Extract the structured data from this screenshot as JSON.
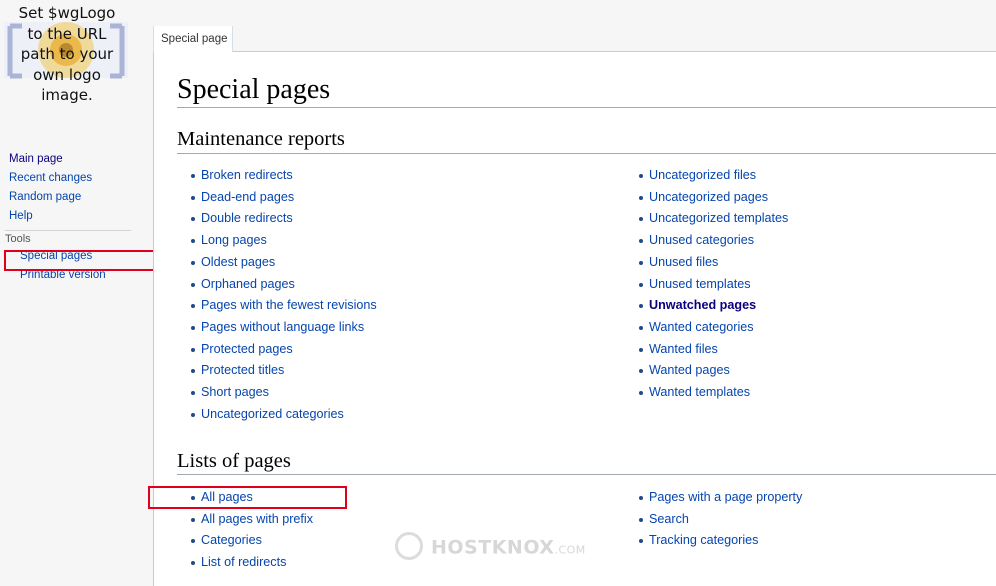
{
  "logo": {
    "text": "Set $wgLogo\nto the URL\npath to your\nown logo\nimage."
  },
  "sidebar": {
    "navigation": [
      {
        "label": "Main page"
      },
      {
        "label": "Recent changes"
      },
      {
        "label": "Random page"
      },
      {
        "label": "Help"
      }
    ],
    "tools_heading": "Tools",
    "tools": [
      {
        "label": "Special pages"
      },
      {
        "label": "Printable version"
      }
    ]
  },
  "tabs": [
    {
      "label": "Special page"
    }
  ],
  "page": {
    "title": "Special pages"
  },
  "sections": [
    {
      "title": "Maintenance reports",
      "left": [
        "Broken redirects",
        "Dead-end pages",
        "Double redirects",
        "Long pages",
        "Oldest pages",
        "Orphaned pages",
        "Pages with the fewest revisions",
        "Pages without language links",
        "Protected pages",
        "Protected titles",
        "Short pages",
        "Uncategorized categories"
      ],
      "right": [
        "Uncategorized files",
        "Uncategorized pages",
        "Uncategorized templates",
        "Unused categories",
        "Unused files",
        "Unused templates",
        "Unwatched pages",
        "Wanted categories",
        "Wanted files",
        "Wanted pages",
        "Wanted templates"
      ]
    },
    {
      "title": "Lists of pages",
      "left": [
        "All pages",
        "All pages with prefix",
        "Categories",
        "List of redirects"
      ],
      "right": [
        "Pages with a page property",
        "Search",
        "Tracking categories"
      ]
    }
  ],
  "watermark": {
    "brand": "HOSTKNOX",
    "suffix": ".COM"
  },
  "colors": {
    "link": "#0645ad",
    "visited": "#0b0080",
    "highlight": "#e0001b"
  }
}
